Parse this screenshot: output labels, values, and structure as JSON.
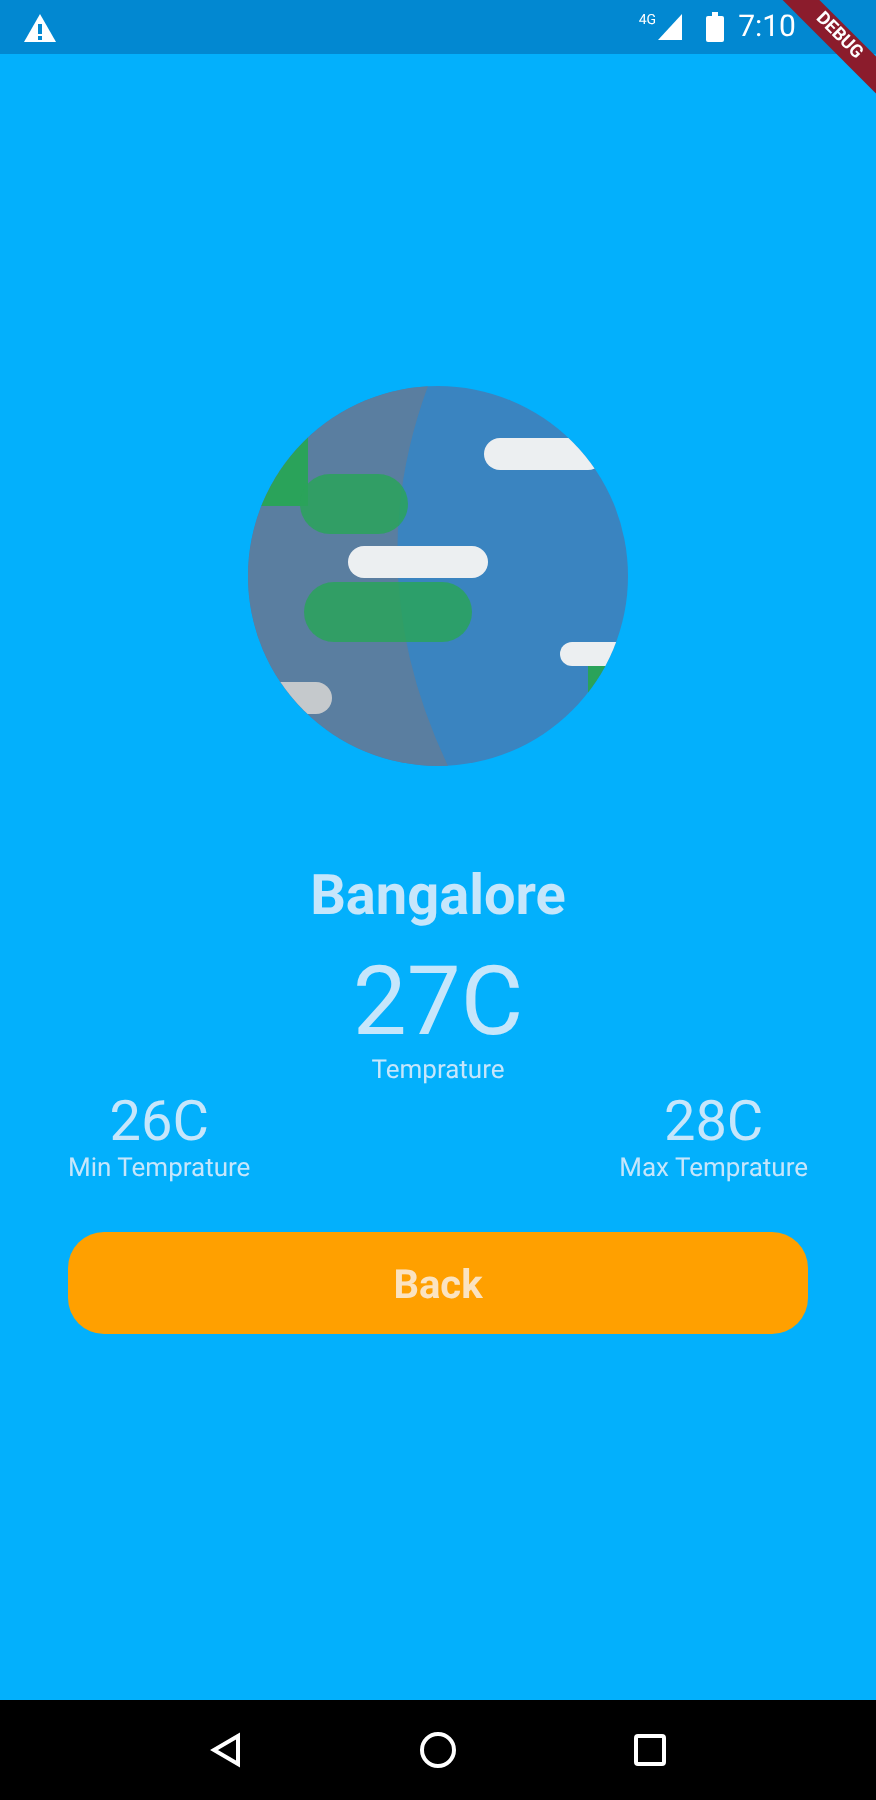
{
  "status_bar": {
    "time": "7:10",
    "network": "4G"
  },
  "debug_banner": "DEBUG",
  "city": "Bangalore",
  "temperature": {
    "value": "27C",
    "label": "Temprature"
  },
  "min": {
    "value": "26C",
    "label": "Min Temprature"
  },
  "max": {
    "value": "28C",
    "label": "Max Temprature"
  },
  "button": "Back"
}
